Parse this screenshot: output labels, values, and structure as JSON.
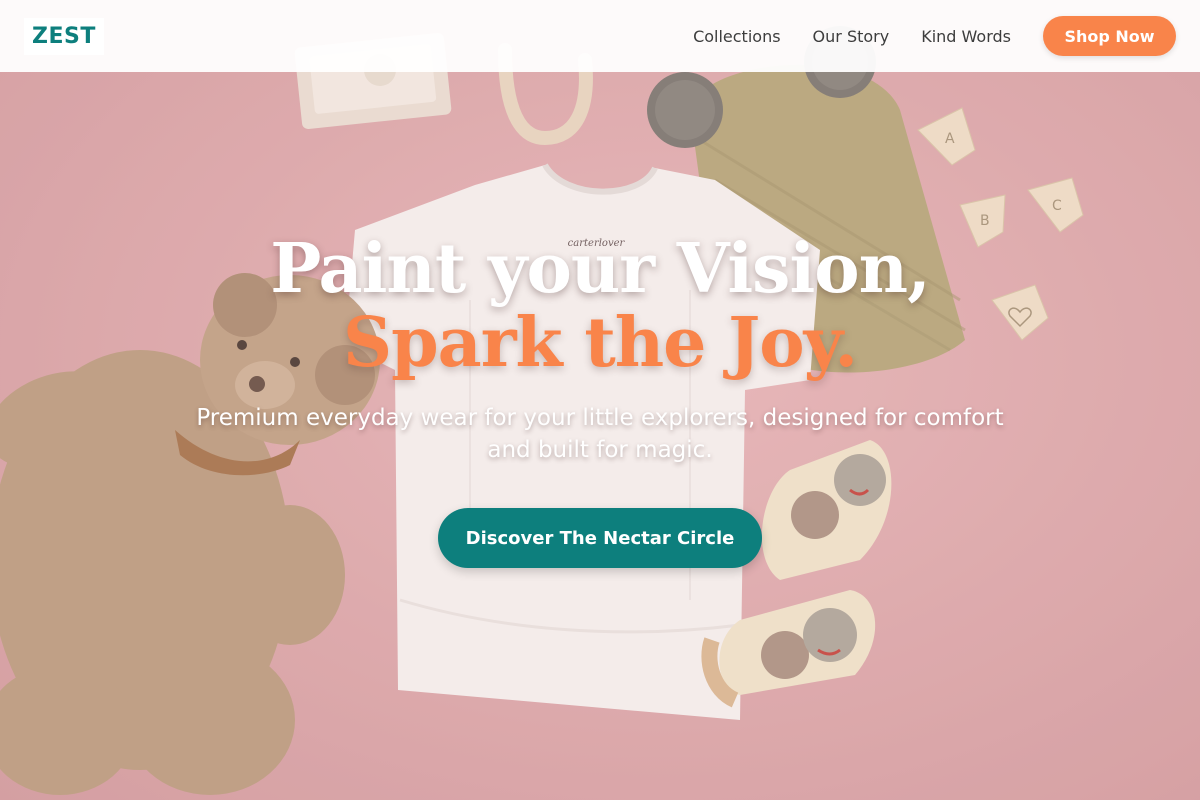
{
  "header": {
    "logo": "ZEST",
    "nav": [
      {
        "label": "Collections"
      },
      {
        "label": "Our Story"
      },
      {
        "label": "Kind Words"
      }
    ],
    "cta_label": "Shop Now"
  },
  "hero": {
    "headline_line1": "Paint your Vision,",
    "headline_line2": "Spark the Joy.",
    "subtext": "Premium everyday wear for your little explorers, designed for comfort and built for magic.",
    "cta_label": "Discover The Nectar Circle",
    "tshirt_tag": "carterlover",
    "banner_letters": [
      "A",
      "B",
      "C"
    ]
  },
  "colors": {
    "brand_teal": "#0d7f7d",
    "accent_orange": "#f9844a",
    "background_pink": "#d9a3a6"
  },
  "icons": {
    "headline_background": "baby-flatlay-image"
  }
}
